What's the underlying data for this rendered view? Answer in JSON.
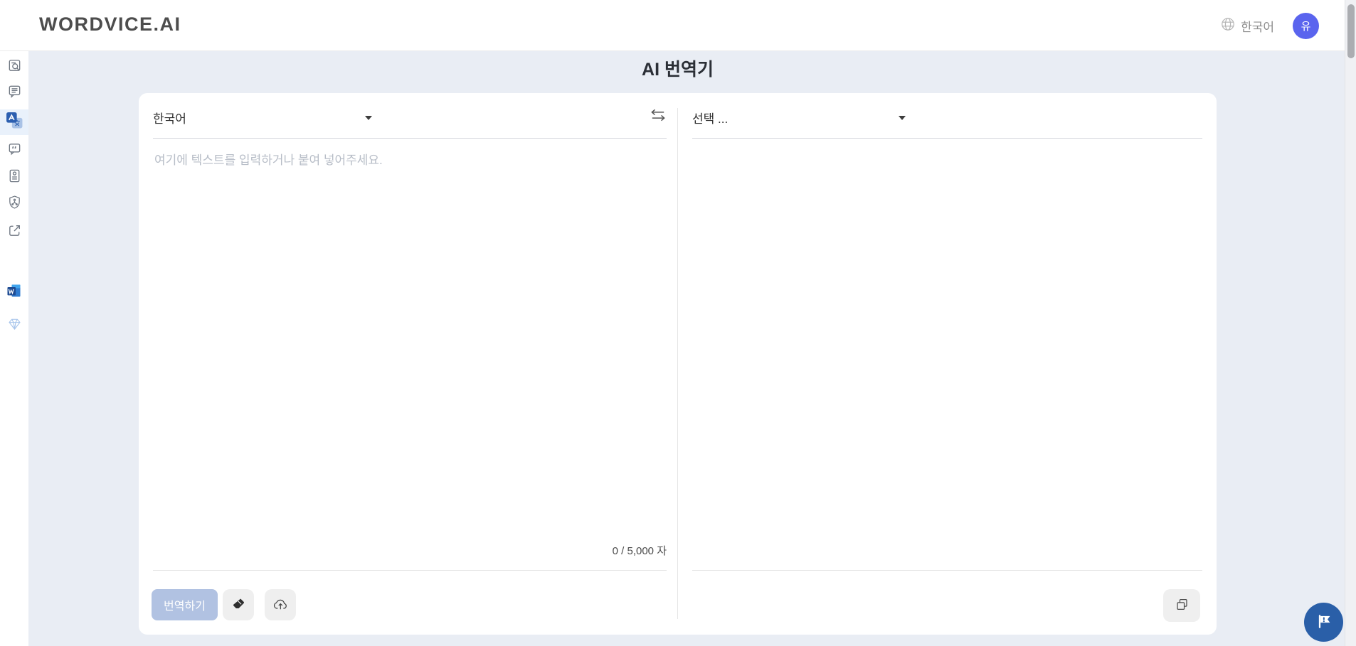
{
  "header": {
    "logo": "WORDVICE.AI",
    "ui_language": "한국어",
    "avatar_initial": "유"
  },
  "sidebar": {
    "active_icon": "translate-icon",
    "items": [
      {
        "icon": "document-search-icon",
        "active": false
      },
      {
        "icon": "chat-lines-icon",
        "active": false
      },
      {
        "icon": "translate-icon",
        "active": true
      },
      {
        "icon": "quote-bubble-icon",
        "active": false
      },
      {
        "icon": "document-profile-icon",
        "active": false
      },
      {
        "icon": "shield-icon",
        "active": false
      },
      {
        "icon": "external-link-icon",
        "active": false
      },
      {
        "icon": "ms-word-icon",
        "active": false
      },
      {
        "icon": "diamond-icon",
        "active": false
      }
    ]
  },
  "page": {
    "title": "AI 번역기"
  },
  "source_panel": {
    "language_selected": "한국어",
    "placeholder": "여기에 텍스트를 입력하거나 붙여 넣어주세요.",
    "value": "",
    "char_counter": "0 / 5,000 자",
    "translate_button": "번역하기",
    "tool_icons": [
      "eraser-icon",
      "cloud-upload-icon"
    ]
  },
  "target_panel": {
    "language_selected": "선택 ...",
    "value": "",
    "tool_icons": [
      "copy-icon"
    ]
  },
  "floating_button": {
    "icon": "flag-exclamation-icon"
  },
  "colors": {
    "page_background": "#e9edf4",
    "avatar_background": "#5a64ee",
    "active_sidebar_background": "#e9f1fb",
    "active_icon_blue": "#2c5fb0",
    "translate_button_background": "#b1c2e2",
    "floating_button_background": "#2a5fa8",
    "placeholder_text": "#b7bdc7"
  }
}
